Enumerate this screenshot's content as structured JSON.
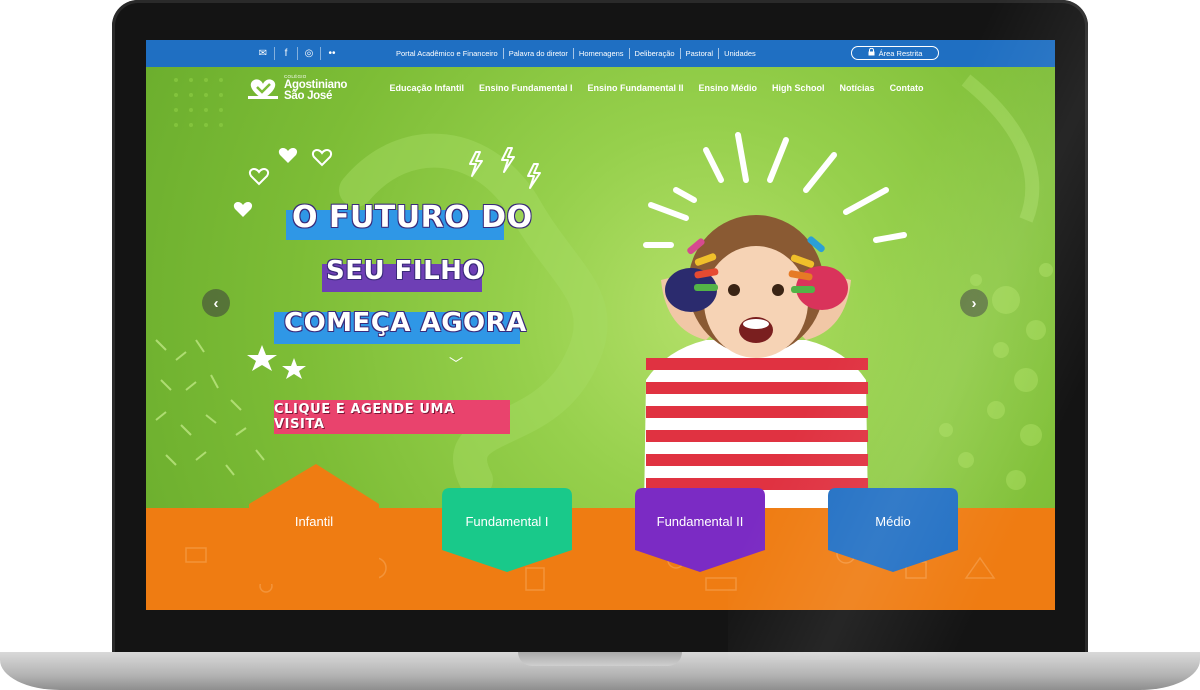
{
  "topbar": {
    "social": [
      {
        "icon": "mail-icon",
        "glyph": "✉"
      },
      {
        "icon": "facebook-icon",
        "glyph": "f"
      },
      {
        "icon": "instagram-icon",
        "glyph": "◎"
      },
      {
        "icon": "flickr-icon",
        "glyph": "••"
      }
    ],
    "links": [
      "Portal Acadêmico e Financeiro",
      "Palavra do diretor",
      "Homenagens",
      "Deliberação",
      "Pastoral",
      "Unidades"
    ],
    "restricted_label": "Área Restrita"
  },
  "logo": {
    "small": "COLÉGIO",
    "line1": "Agostiniano",
    "line2": "São José"
  },
  "nav": [
    "Educação Infantil",
    "Ensino Fundamental I",
    "Ensino Fundamental II",
    "Ensino Médio",
    "High School",
    "Notícias",
    "Contato"
  ],
  "hero": {
    "headline": [
      "O FUTURO DO",
      "SEU FILHO",
      "COMEÇA AGORA"
    ],
    "cta": "CLIQUE E AGENDE UMA VISITA"
  },
  "levels": [
    "Infantil",
    "Fundamental I",
    "Fundamental II",
    "Médio"
  ],
  "colors": {
    "topbar": "#1f6fc2",
    "orange": "#ef7c12",
    "infantil": "#ef7c12",
    "fund1": "#19c98a",
    "fund2": "#7b2bc4",
    "medio": "#2270c4",
    "band_blue": "#2f97e6",
    "band_purple": "#6e3fb5",
    "cta_pink": "#e9436d"
  }
}
